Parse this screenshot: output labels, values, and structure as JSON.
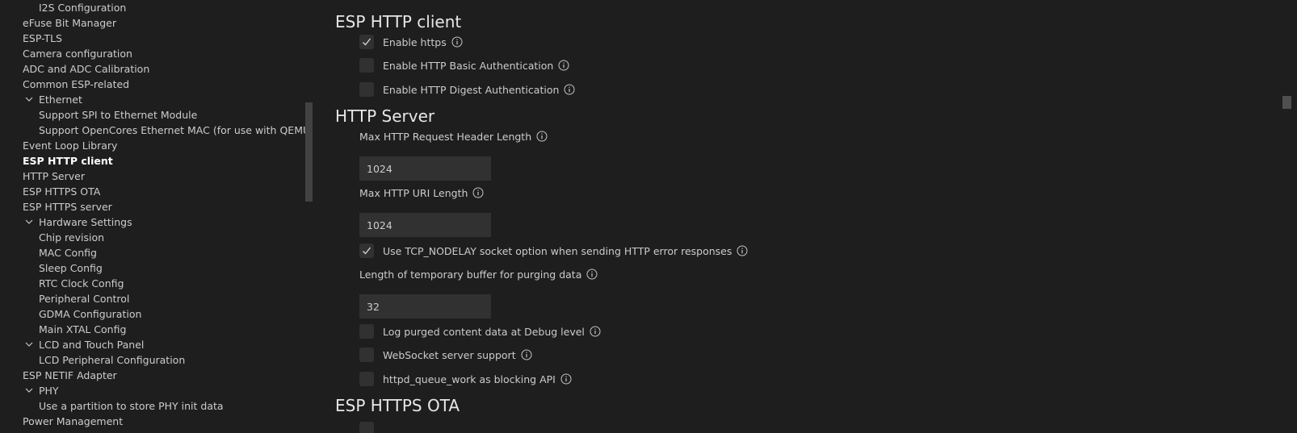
{
  "sidebar": {
    "items": [
      {
        "label": "I2S Configuration"
      },
      {
        "label": "eFuse Bit Manager"
      },
      {
        "label": "ESP-TLS"
      },
      {
        "label": "Camera configuration"
      },
      {
        "label": "ADC and ADC Calibration"
      },
      {
        "label": "Common ESP-related"
      },
      {
        "label": "Ethernet"
      },
      {
        "label": "Support SPI to Ethernet Module"
      },
      {
        "label": "Support OpenCores Ethernet MAC (for use with QEMU)"
      },
      {
        "label": "Event Loop Library"
      },
      {
        "label": "ESP HTTP client"
      },
      {
        "label": "HTTP Server"
      },
      {
        "label": "ESP HTTPS OTA"
      },
      {
        "label": "ESP HTTPS server"
      },
      {
        "label": "Hardware Settings"
      },
      {
        "label": "Chip revision"
      },
      {
        "label": "MAC Config"
      },
      {
        "label": "Sleep Config"
      },
      {
        "label": "RTC Clock Config"
      },
      {
        "label": "Peripheral Control"
      },
      {
        "label": "GDMA Configuration"
      },
      {
        "label": "Main XTAL Config"
      },
      {
        "label": "LCD and Touch Panel"
      },
      {
        "label": "LCD Peripheral Configuration"
      },
      {
        "label": "ESP NETIF Adapter"
      },
      {
        "label": "PHY"
      },
      {
        "label": "Use a partition to store PHY init data"
      },
      {
        "label": "Power Management"
      }
    ]
  },
  "main": {
    "http_client": {
      "title": "ESP HTTP client",
      "enable_https": {
        "label": "Enable https",
        "checked": true
      },
      "basic_auth": {
        "label": "Enable HTTP Basic Authentication",
        "checked": false
      },
      "digest_auth": {
        "label": "Enable HTTP Digest Authentication",
        "checked": false
      }
    },
    "http_server": {
      "title": "HTTP Server",
      "max_header_len": {
        "label": "Max HTTP Request Header Length",
        "value": "1024"
      },
      "max_uri_len": {
        "label": "Max HTTP URI Length",
        "value": "1024"
      },
      "tcp_nodelay": {
        "label": "Use TCP_NODELAY socket option when sending HTTP error responses",
        "checked": true
      },
      "purge_buf_len": {
        "label": "Length of temporary buffer for purging data",
        "value": "32"
      },
      "log_purged": {
        "label": "Log purged content data at Debug level",
        "checked": false
      },
      "websocket": {
        "label": "WebSocket server support",
        "checked": false
      },
      "queue_work": {
        "label": "httpd_queue_work as blocking API",
        "checked": false
      }
    },
    "https_ota": {
      "title": "ESP HTTPS OTA"
    }
  }
}
